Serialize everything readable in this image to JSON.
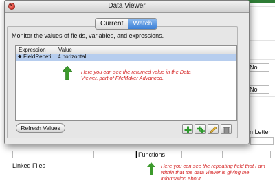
{
  "window": {
    "title": "Data Viewer",
    "tabs": [
      "Current",
      "Watch"
    ],
    "active_tab": "Watch",
    "description": "Monitor the values of fields, variables, and expressions."
  },
  "table": {
    "columns": [
      "Expression",
      "Value"
    ],
    "rows": [
      {
        "expression": "FieldRepeti...",
        "value": "4 horizontal"
      }
    ]
  },
  "buttons": {
    "refresh": "Refresh Values",
    "toolbar_icons": [
      "add-icon",
      "add-multiple-icon",
      "edit-icon",
      "delete-icon"
    ]
  },
  "annotations": {
    "viewer_note": "Here you can see the returned value in the Data Viewer, part of FileMaker Advanced.",
    "field_note": "Here you can see the repeating field that I am within that the data viewer is giving me information about."
  },
  "background": {
    "no_1": "No",
    "no_2": "No",
    "letter": "n Letter",
    "functions_field": "Functions",
    "linked_files": "Linked Files"
  },
  "colors": {
    "accent_tab": "#3a7fd6",
    "annotation_red": "#d42020",
    "arrow_green": "#3c9a2c",
    "selection_row": "#b6cdee"
  }
}
